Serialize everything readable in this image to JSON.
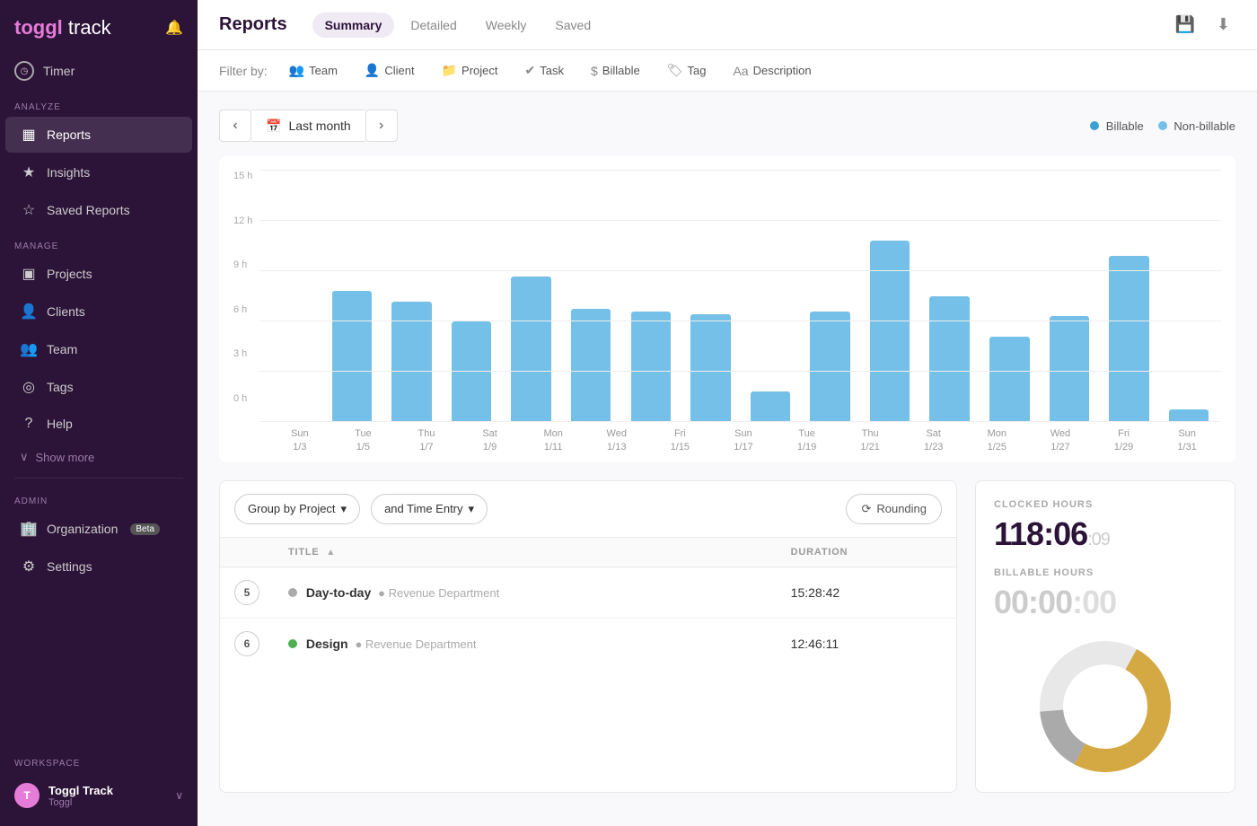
{
  "sidebar": {
    "logo": {
      "toggl": "toggl",
      "track": "track"
    },
    "timer": {
      "label": "Timer"
    },
    "sections": [
      {
        "label": "ANALYZE",
        "items": [
          {
            "id": "reports",
            "icon": "▦",
            "label": "Reports",
            "active": true
          },
          {
            "id": "insights",
            "icon": "★",
            "label": "Insights",
            "active": false
          },
          {
            "id": "saved-reports",
            "icon": "☆",
            "label": "Saved Reports",
            "active": false
          }
        ]
      },
      {
        "label": "MANAGE",
        "items": [
          {
            "id": "projects",
            "icon": "▣",
            "label": "Projects",
            "active": false
          },
          {
            "id": "clients",
            "icon": "👤",
            "label": "Clients",
            "active": false
          },
          {
            "id": "team",
            "icon": "👥",
            "label": "Team",
            "active": false
          },
          {
            "id": "tags",
            "icon": "◎",
            "label": "Tags",
            "active": false
          },
          {
            "id": "help",
            "icon": "?",
            "label": "Help",
            "active": false
          }
        ]
      }
    ],
    "show_more": "Show more",
    "admin_label": "ADMIN",
    "admin_items": [
      {
        "id": "organization",
        "icon": "🏢",
        "label": "Organization",
        "badge": "Beta"
      },
      {
        "id": "settings",
        "icon": "⚙",
        "label": "Settings"
      }
    ],
    "workspace": {
      "label": "WORKSPACE",
      "name": "Toggl Track",
      "sub": "Toggl"
    }
  },
  "header": {
    "title": "Reports",
    "tabs": [
      {
        "id": "summary",
        "label": "Summary",
        "active": true
      },
      {
        "id": "detailed",
        "label": "Detailed",
        "active": false
      },
      {
        "id": "weekly",
        "label": "Weekly",
        "active": false
      },
      {
        "id": "saved",
        "label": "Saved",
        "active": false
      }
    ],
    "save_icon": "💾",
    "download_icon": "⬇"
  },
  "filter_bar": {
    "label": "Filter by:",
    "filters": [
      {
        "id": "team",
        "icon": "👥",
        "label": "Team"
      },
      {
        "id": "client",
        "icon": "👤",
        "label": "Client"
      },
      {
        "id": "project",
        "icon": "📁",
        "label": "Project"
      },
      {
        "id": "task",
        "icon": "✔",
        "label": "Task"
      },
      {
        "id": "billable",
        "icon": "$",
        "label": "Billable"
      },
      {
        "id": "tag",
        "icon": "🏷",
        "label": "Tag"
      },
      {
        "id": "description",
        "icon": "Aa",
        "label": "Description"
      }
    ]
  },
  "date_nav": {
    "prev_label": "‹",
    "next_label": "›",
    "range_label": "Last month",
    "legend": [
      {
        "id": "billable",
        "color": "#3b9fd4",
        "label": "Billable"
      },
      {
        "id": "non-billable",
        "color": "#74c0e8",
        "label": "Non-billable"
      }
    ]
  },
  "chart": {
    "y_labels": [
      "0 h",
      "3 h",
      "6 h",
      "9 h",
      "12 h",
      "15 h"
    ],
    "bars": [
      {
        "day": "Sun",
        "date": "1/3",
        "height_pct": 0
      },
      {
        "day": "Tue",
        "date": "1/5",
        "height_pct": 52
      },
      {
        "day": "Thu",
        "date": "1/7",
        "height_pct": 48
      },
      {
        "day": "Sat",
        "date": "1/9",
        "height_pct": 40
      },
      {
        "day": "Mon",
        "date": "1/11",
        "height_pct": 58
      },
      {
        "day": "Wed",
        "date": "1/13",
        "height_pct": 45
      },
      {
        "day": "Fri",
        "date": "1/15",
        "height_pct": 44
      },
      {
        "day": "Sun",
        "date": "1/17",
        "height_pct": 43
      },
      {
        "day": "Tue",
        "date": "1/19",
        "height_pct": 12
      },
      {
        "day": "Tue",
        "date": "1/19",
        "height_pct": 44
      },
      {
        "day": "Thu",
        "date": "1/21",
        "height_pct": 72
      },
      {
        "day": "Sat",
        "date": "1/23",
        "height_pct": 50
      },
      {
        "day": "Mon",
        "date": "1/25",
        "height_pct": 34
      },
      {
        "day": "Wed",
        "date": "1/27",
        "height_pct": 42
      },
      {
        "day": "Fri",
        "date": "1/29",
        "height_pct": 66
      },
      {
        "day": "Sun",
        "date": "1/31",
        "height_pct": 5
      }
    ],
    "x_labels": [
      {
        "day": "Sun",
        "date": "1/3"
      },
      {
        "day": "Tue",
        "date": "1/5"
      },
      {
        "day": "Thu",
        "date": "1/7"
      },
      {
        "day": "Sat",
        "date": "1/9"
      },
      {
        "day": "Mon",
        "date": "1/11"
      },
      {
        "day": "Wed",
        "date": "1/13"
      },
      {
        "day": "Fri",
        "date": "1/15"
      },
      {
        "day": "Sun",
        "date": "1/17"
      },
      {
        "day": "Tue",
        "date": "1/19"
      },
      {
        "day": "Thu",
        "date": "1/21"
      },
      {
        "day": "Sat",
        "date": "1/23"
      },
      {
        "day": "Mon",
        "date": "1/25"
      },
      {
        "day": "Wed",
        "date": "1/27"
      },
      {
        "day": "Fri",
        "date": "1/29"
      },
      {
        "day": "Sun",
        "date": "1/31"
      }
    ]
  },
  "table": {
    "group_by": "Group by Project",
    "and_entry": "and Time Entry",
    "rounding": "Rounding",
    "columns": [
      {
        "id": "expand",
        "label": ""
      },
      {
        "id": "title",
        "label": "TITLE",
        "sortable": true
      },
      {
        "id": "duration",
        "label": "DURATION"
      }
    ],
    "rows": [
      {
        "count": "5",
        "project": "Day-to-day",
        "project_color": "#aaa",
        "client": "Revenue Department",
        "duration": "15:28:42"
      },
      {
        "count": "6",
        "project": "Design",
        "project_color": "#4caf50",
        "client": "Revenue Department",
        "duration": "12:46:11"
      }
    ]
  },
  "stats": {
    "clocked_label": "CLOCKED HOURS",
    "clocked_value": "118:06",
    "clocked_seconds": "09",
    "billable_label": "BILLABLE HOURS",
    "billable_value": "0:00",
    "billable_seconds": "00"
  }
}
